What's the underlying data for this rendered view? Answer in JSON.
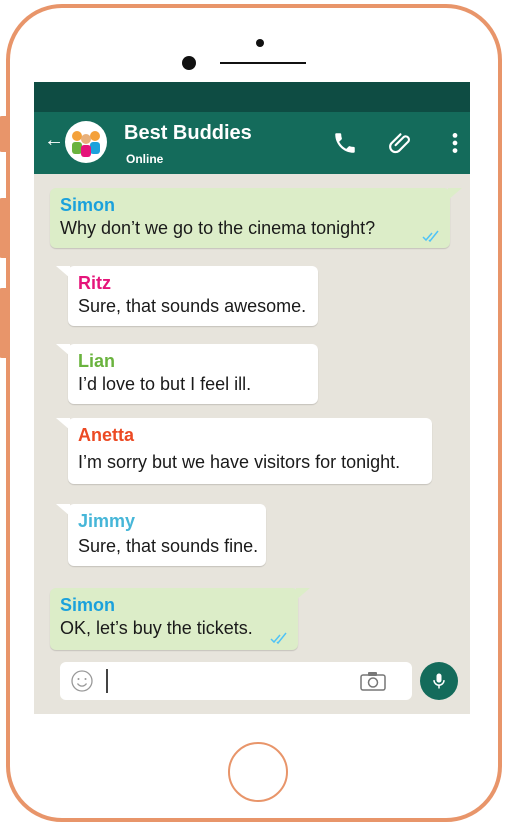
{
  "colors": {
    "frame": "#e8956a",
    "header": "#146b5b",
    "status_bar": "#0e4c43",
    "chat_bg": "#e7e4dc",
    "out_bubble": "#dcedc8",
    "in_bubble": "#ffffff",
    "tick": "#4fc3f7"
  },
  "header": {
    "back_icon": "back-arrow-icon",
    "avatar_icon": "group-avatar-icon",
    "title": "Best Buddies",
    "status": "Online",
    "icons": [
      "phone-icon",
      "paperclip-icon",
      "more-vertical-icon"
    ]
  },
  "messages": [
    {
      "sender": "Simon",
      "text": "Why don’t  we  go  to the cinema tonight?",
      "direction": "out",
      "sender_color": "#1ba1dc",
      "read_icon": "double-check-icon"
    },
    {
      "sender": "Ritz",
      "text": "Sure, that sounds awesome.",
      "direction": "in",
      "sender_color": "#e5147a"
    },
    {
      "sender": "Lian",
      "text": "I’d love to but I feel ill.",
      "direction": "in",
      "sender_color": "#6ab33e"
    },
    {
      "sender": "Anetta",
      "text": "I’m sorry but we have visitors for tonight.",
      "direction": "in",
      "sender_color": "#ec4a24"
    },
    {
      "sender": "Jimmy",
      "text": "Sure, that sounds fine.",
      "direction": "in",
      "sender_color": "#46b6d8"
    },
    {
      "sender": "Simon",
      "text": "OK, let’s buy the tickets.",
      "direction": "out",
      "sender_color": "#1ba1dc",
      "read_icon": "double-check-icon"
    }
  ],
  "input": {
    "emoji_icon": "smiley-icon",
    "value": "",
    "camera_icon": "camera-icon",
    "mic_icon": "mic-icon"
  }
}
